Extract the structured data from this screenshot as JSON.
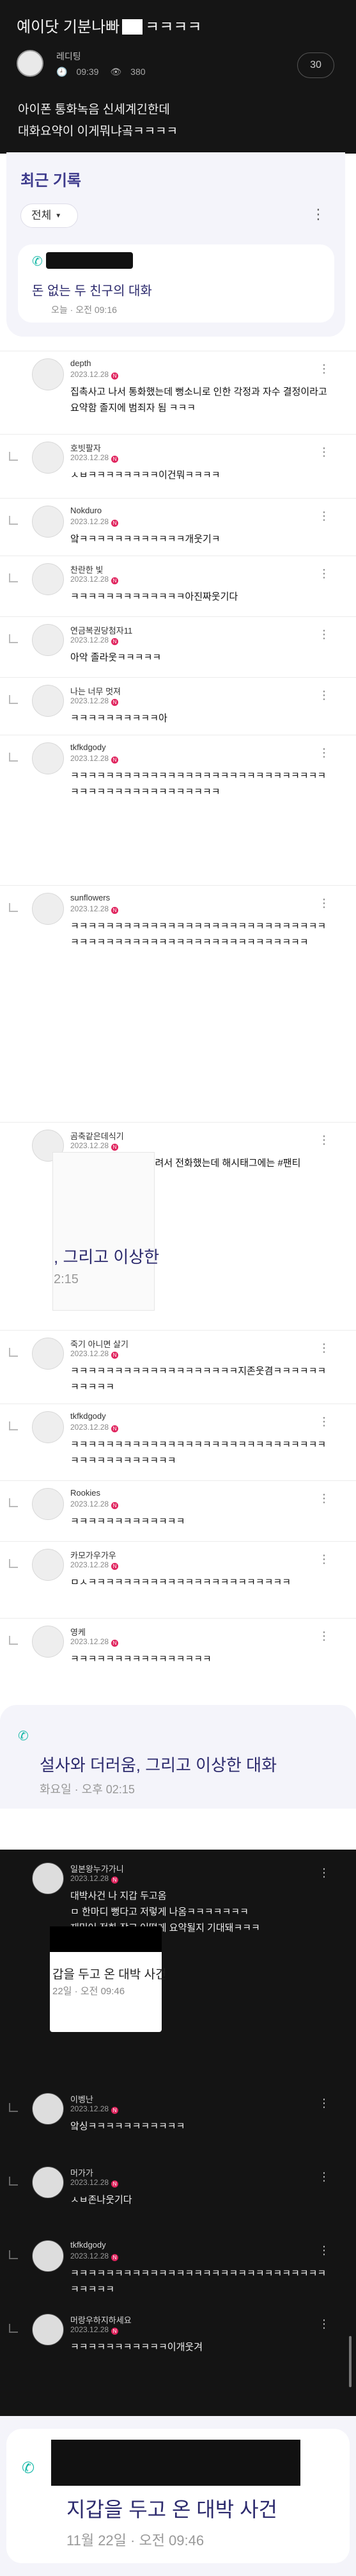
{
  "post": {
    "title_part1": "예이닷 기분나빠",
    "title_part2": "ㅋㅋㅋㅋ",
    "author": "레디팅",
    "time": "09:39",
    "views": "380",
    "comment_count": "30",
    "body_line1": "아이폰 통화녹음 신세계긴한데",
    "body_line2": "대화요약이 이게뭐냐곸ㅋㅋㅋㅋ"
  },
  "call_log": {
    "title": "최근 기록",
    "filter_label": "전체",
    "entry_name": "돈 없는 두 친구의 대화",
    "entry_time": "오늘 · 오전 09:16"
  },
  "comments": [
    {
      "nick": "depth",
      "date": "2023.12.28",
      "text": "집촉사고 나서 통화했는데 뻥소니로 인한 각정과 자수 결정이라고\n요약함 졸지에 범죄자 됨 ㅋㅋㅋ"
    },
    {
      "nick": "호빗팔자",
      "date": "2023.12.28",
      "text": "ㅅㅂㅋㅋㅋㅋㅋㅋㅋㅋ이건뭐ㅋㅋㅋㅋ"
    },
    {
      "nick": "Nokduro",
      "date": "2023.12.28",
      "text": "앜ㅋㅋㅋㅋㅋㅋㅋㅋㅋㅋㅋㅋ개웃기ㅋ"
    },
    {
      "nick": "찬란한 빛",
      "date": "2023.12.28",
      "text": "ㅋㅋㅋㅋㅋㅋㅋㅋㅋㅋㅋㅋㅋ아진짜웃기다"
    },
    {
      "nick": "연금복권당첨자11",
      "date": "2023.12.28",
      "text": "아악 졸라웃ㅋㅋㅋㅋㅋ"
    },
    {
      "nick": "나는 너무 멋져",
      "date": "2023.12.28",
      "text": "ㅋㅋㅋㅋㅋㅋㅋㅋㅋㅋ아"
    },
    {
      "nick": "tkfkdgody",
      "date": "2023.12.28",
      "text": "ㅋㅋㅋㅋㅋㅋㅋㅋㅋㅋㅋㅋㅋㅋㅋㅋㅋㅋㅋㅋㅋㅋㅋㅋㅋㅋㅋㅋㅋㅋㅋㅋㅋㅋㅋㅋㅋㅋㅋㅋㅋㅋㅋㅋㅋㅋ"
    },
    {
      "nick": "sunflowers",
      "date": "2023.12.28",
      "text": "ㅋㅋㅋㅋㅋㅋㅋㅋㅋㅋㅋㅋㅋㅋㅋㅋㅋㅋㅋㅋㅋㅋㅋㅋㅋㅋㅋㅋㅋㅋㅋㅋㅋㅋㅋㅋㅋㅋㅋㅋㅋㅋㅋㅋㅋㅋㅋㅋㅋㅋㅋㅋㅋㅋㅋㅋ"
    },
    {
      "nick": "곰축같은데식기",
      "date": "2023.12.28",
      "text": "친구 노로바이러스 걸려서 전화했는데 해시태그에는 #팬티\n있음ㅋㅋㅋㅋㅋ"
    },
    {
      "nick": "죽기 아니면 살기",
      "date": "2023.12.28",
      "text": "ㅋㅋㅋㅋㅋㅋㅋㅋㅋㅋㅋㅋㅋㅋㅋㅋㅋㅋㅋ지존웃겸ㅋㅋㅋㅋㅋㅋㅋㅋㅋㅋㅋ"
    },
    {
      "nick": "tkfkdgody",
      "date": "2023.12.28",
      "text": "ㅋㅋㅋㅋㅋㅋㅋㅋㅋㅋㅋㅋㅋㅋㅋㅋㅋㅋㅋㅋㅋㅋㅋㅋㅋㅋㅋㅋㅋㅋㅋㅋㅋㅋㅋㅋㅋㅋㅋㅋㅋ"
    },
    {
      "nick": "Rookies",
      "date": "2023.12.28",
      "text": "ㅋㅋㅋㅋㅋㅋㅋㅋㅋㅋㅋㅋㅋ"
    },
    {
      "nick": "카모가우가우",
      "date": "2023.12.28",
      "text": "ㅁㅅㅋㅋㅋㅋㅋㅋㅋㅋㅋㅋㅋㅋㅋㅋㅋㅋㅋㅋㅋㅋㅋㅋㅋ"
    },
    {
      "nick": "영케",
      "date": "2023.12.28",
      "text": "ㅋㅋㅋㅋㅋㅋㅋㅋㅋㅋㅋㅋㅋㅋㅋㅋ"
    }
  ],
  "embed": {
    "title": ", 그리고 이상한",
    "time": "2:15"
  },
  "mid_card": {
    "title": "설사와 더러움, 그리고 이상한 대화",
    "time": "화요일 · 오후 02:15"
  },
  "dark_comments": [
    {
      "nick": "일본왕누가가니",
      "date": "2023.12.28",
      "text": "대박사건 나 지갑 두고옴\nㅁ 한마디 뻥다고 저렇게 나옴ㅋㅋㅋㅋㅋㅋㅋ\n재밌어 전화 잡고 어떻게 요약될지 기대돼ㅋㅋㅋ"
    },
    {
      "nick": "이벵난",
      "date": "2023.12.28",
      "text": "앜싱ㅋㅋㅋㅋㅋㅋㅋㅋㅋㅋㅋ"
    },
    {
      "nick": "머가가",
      "date": "2023.12.28",
      "text": "ㅅㅂ존나웃기다"
    },
    {
      "nick": "tkfkdgody",
      "date": "2023.12.28",
      "text": "ㅋㅋㅋㅋㅋㅋㅋㅋㅋㅋㅋㅋㅋㅋㅋㅋㅋㅋㅋㅋㅋㅋㅋㅋㅋㅋㅋㅋㅋㅋㅋㅋㅋㅋ"
    },
    {
      "nick": "머랑우하지하세요",
      "date": "2023.12.28",
      "text": "ㅋㅋㅋㅋㅋㅋㅋㅋㅋㅋㅋ이개웃겨"
    }
  ],
  "dark_embed": {
    "title": "갑을 두고 온 대박 사건",
    "time": "22일 · 오전 09:46"
  },
  "bottom_card": {
    "title": "지갑을 두고 온 대박 사건",
    "time": "11월 22일 · 오전 09:46"
  },
  "colors": {
    "accent": "#2c2a6d",
    "call_icon": "#18b9a8",
    "badge": "#e0245e"
  }
}
